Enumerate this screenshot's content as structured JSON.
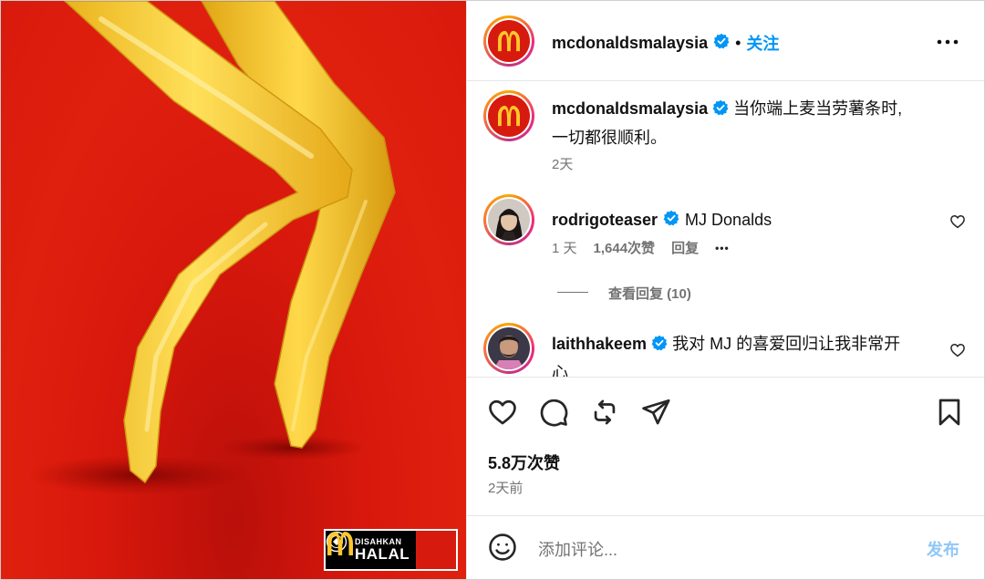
{
  "media": {
    "badge": {
      "line1": "DISAHKAN",
      "line2": "HALAL"
    }
  },
  "header": {
    "username": "mcdonaldsmalaysia",
    "separator": "•",
    "follow_label": "关注",
    "more_icon": "more-horizontal-icon"
  },
  "caption": {
    "username": "mcdonaldsmalaysia",
    "text_line1": "当你端上麦当劳薯条时,",
    "text_line2": "一切都很顺利。",
    "time": "2天"
  },
  "comments": [
    {
      "username": "rodrigoteaser",
      "text": "MJ Donalds",
      "time": "1 天",
      "likes": "1,644次赞",
      "reply_label": "回复",
      "more": "•••",
      "view_replies": "查看回复 (10)"
    },
    {
      "username": "laithhakeem",
      "text_line1": "我对 MJ 的喜爱回归让我非常开",
      "text_line2": "心"
    }
  ],
  "actions": {
    "likes": "5.8万次赞",
    "time": "2天前"
  },
  "composer": {
    "placeholder": "添加评论...",
    "post_label": "发布"
  },
  "colors": {
    "accent": "#0095f6",
    "mcd_red": "#d71a0e",
    "mcd_yellow": "#ffc72c"
  }
}
